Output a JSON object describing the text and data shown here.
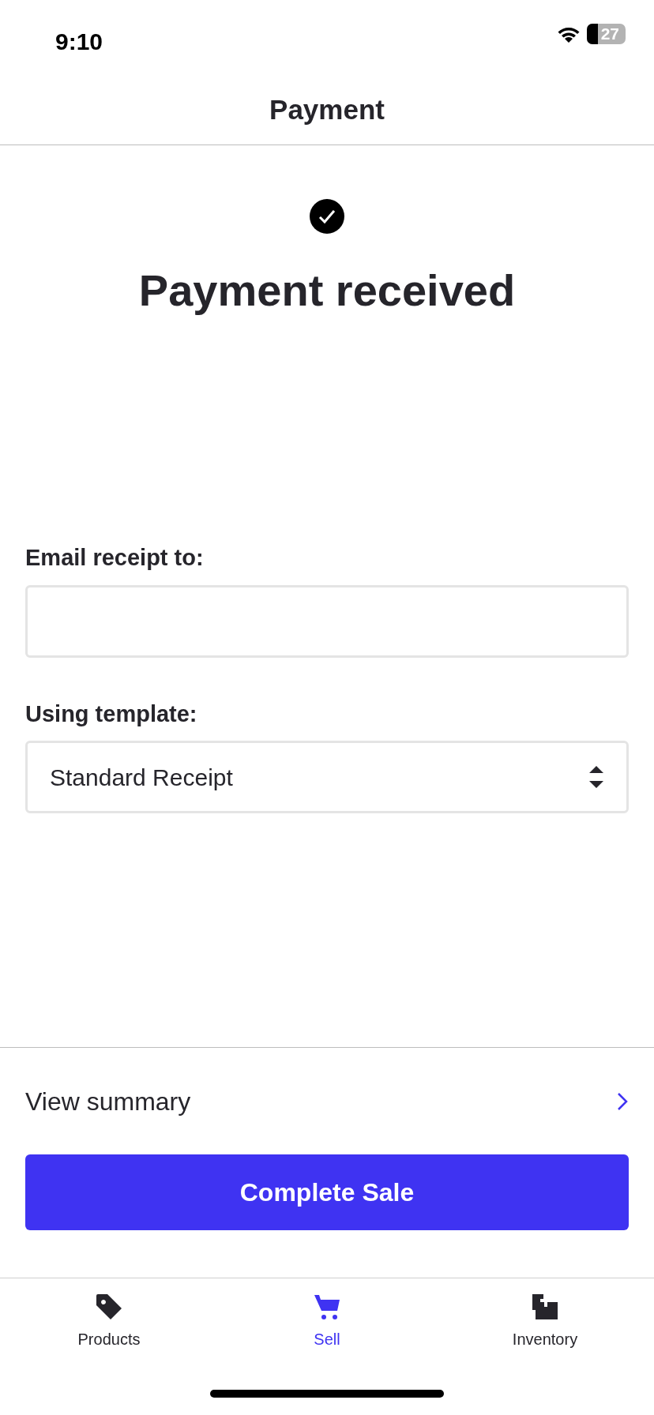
{
  "status_bar": {
    "time": "9:10",
    "battery": "27"
  },
  "header": {
    "title": "Payment"
  },
  "result": {
    "title": "Payment received"
  },
  "form": {
    "email": {
      "label": "Email receipt to:"
    },
    "template": {
      "label": "Using template:",
      "value": "Standard Receipt"
    }
  },
  "summary": {
    "label": "View summary"
  },
  "primary_button": "Complete Sale",
  "tabs": [
    {
      "label": "Products",
      "kind": "tag",
      "selected": false
    },
    {
      "label": "Sell",
      "kind": "cart",
      "selected": true
    },
    {
      "label": "Inventory",
      "kind": "boxes",
      "selected": false
    }
  ]
}
